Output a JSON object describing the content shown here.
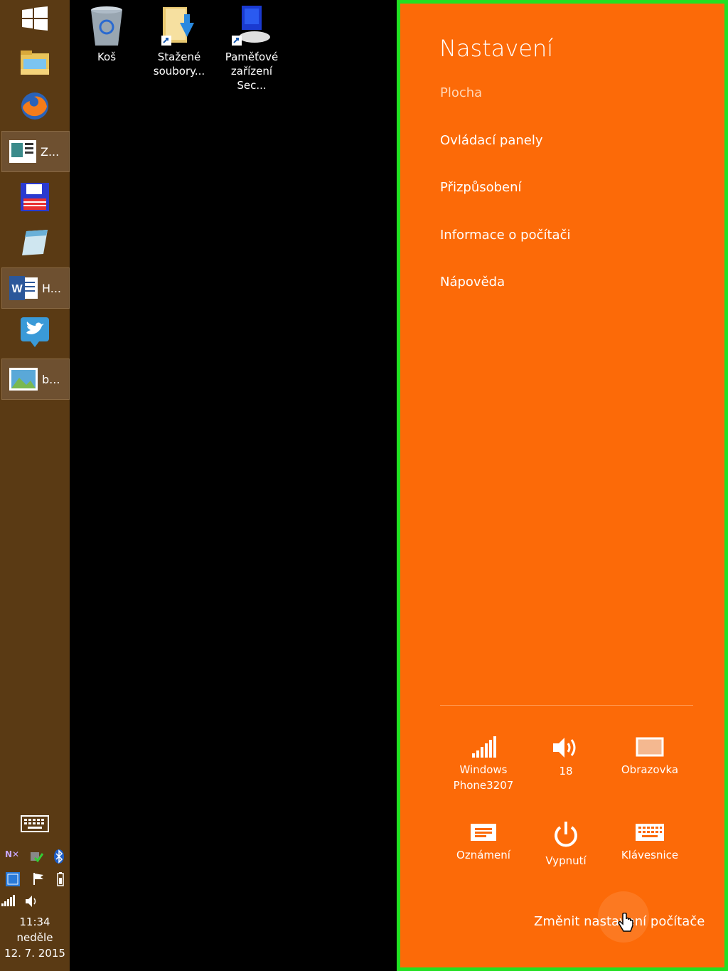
{
  "taskbar": {
    "running": [
      {
        "label": "Z..."
      },
      {
        "label": "H..."
      },
      {
        "label": "b..."
      }
    ],
    "clock": {
      "time": "11:34",
      "day": "neděle",
      "date": "12. 7. 2015"
    }
  },
  "desktop": {
    "icons": [
      {
        "label_line1": "Koš",
        "label_line2": ""
      },
      {
        "label_line1": "Stažené",
        "label_line2": "soubory..."
      },
      {
        "label_line1": "Paměťové",
        "label_line2": "zařízení Sec..."
      }
    ]
  },
  "charm": {
    "title": "Nastavení",
    "links": [
      "Plocha",
      "Ovládací panely",
      "Přizpůsobení",
      "Informace o počítači",
      "Nápověda"
    ],
    "quick_settings": [
      {
        "label": "Windows Phone3207",
        "icon": "wifi-signal-icon"
      },
      {
        "label": "18",
        "icon": "volume-icon"
      },
      {
        "label": "Obrazovka",
        "icon": "screen-icon"
      },
      {
        "label": "Oznámení",
        "icon": "notifications-icon"
      },
      {
        "label": "Vypnutí",
        "icon": "power-icon"
      },
      {
        "label": "Klávesnice",
        "icon": "keyboard-icon"
      }
    ],
    "change_pc_settings": "Změnit nastavení počítače"
  },
  "colors": {
    "charm_bg": "#fc6a08",
    "highlight_border": "#22e022",
    "taskbar_bg": "#5a3a14"
  }
}
